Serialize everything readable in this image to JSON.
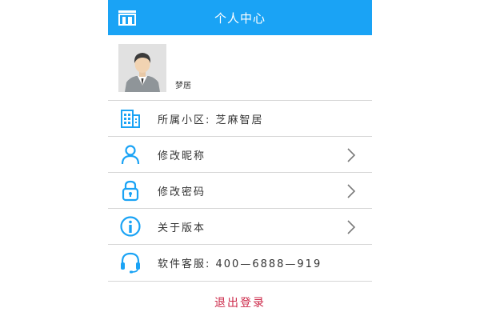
{
  "header": {
    "title": "个人中心",
    "back_icon": "home-door-icon",
    "background": "#1aa3f5"
  },
  "profile": {
    "nickname": "梦居"
  },
  "menu": {
    "items": [
      {
        "label": "所属小区: 芝麻智居",
        "icon": "building-icon"
      },
      {
        "label": "修改昵称",
        "icon": "user-icon"
      },
      {
        "label": "修改密码",
        "icon": "lock-icon"
      },
      {
        "label": "关于版本",
        "icon": "info-icon"
      },
      {
        "label": "软件客服: 400—6888—919",
        "icon": "headset-icon"
      }
    ]
  },
  "logout": {
    "label": "退出登录",
    "color": "#cc2a4a"
  },
  "accent_color": "#1aa3f5"
}
